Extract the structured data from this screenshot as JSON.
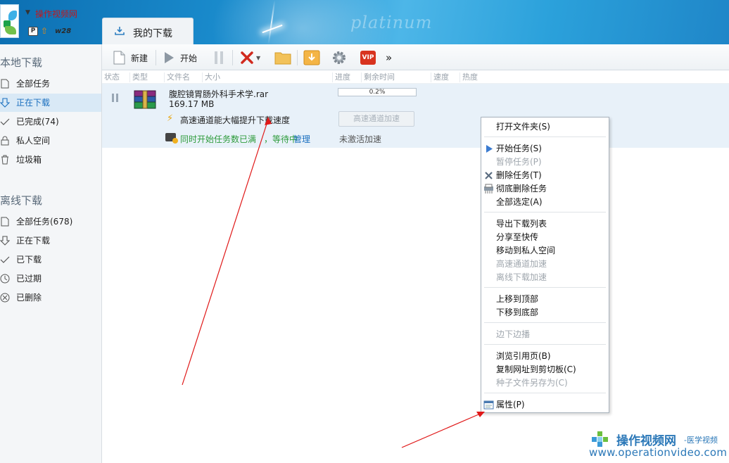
{
  "header": {
    "username": "操作视频网",
    "level": "w28",
    "brand": "platinum",
    "tab_label": "我的下载"
  },
  "sidebar": {
    "local_title": "本地下载",
    "local_items": [
      {
        "label": "全部任务",
        "icon": "document-icon"
      },
      {
        "label": "正在下载",
        "icon": "download-arrow-icon",
        "active": true
      },
      {
        "label": "已完成(74)",
        "icon": "check-icon"
      },
      {
        "label": "私人空间",
        "icon": "lock-icon"
      },
      {
        "label": "垃圾箱",
        "icon": "trash-icon"
      }
    ],
    "offline_title": "离线下载",
    "offline_items": [
      {
        "label": "全部任务(678)",
        "icon": "document-icon"
      },
      {
        "label": "正在下载",
        "icon": "download-arrow-icon"
      },
      {
        "label": "已下载",
        "icon": "check-icon"
      },
      {
        "label": "已过期",
        "icon": "clock-icon"
      },
      {
        "label": "已删除",
        "icon": "circle-x-icon"
      }
    ]
  },
  "toolbar": {
    "new_label": "新建",
    "start_label": "开始",
    "vip_label": "VIP",
    "more_label": "»"
  },
  "columns": [
    "状态",
    "类型",
    "文件名",
    "大小",
    "进度",
    "剩余时间",
    "速度",
    "热度"
  ],
  "task": {
    "name": "腹腔镜胃肠外科手术学.rar",
    "size": "169.17 MB",
    "progress_text": "0.2%",
    "progress": 0.002,
    "boost_msg": "高速通道能大幅提升下载速度",
    "boost_button": "高速通道加速",
    "warn_msg": "同时开始任务数已满",
    "warn_wait": "，等待中",
    "warn_manage": "管理",
    "not_activated": "未激活加速"
  },
  "context_menu": {
    "items": [
      {
        "label": "打开文件夹(S)",
        "enabled": true
      },
      {
        "label": "开始任务(S)",
        "enabled": true,
        "icon": "play-icon"
      },
      {
        "label": "暂停任务(P)",
        "enabled": false
      },
      {
        "label": "删除任务(T)",
        "enabled": true,
        "icon": "delete-x-icon"
      },
      {
        "label": "彻底删除任务",
        "enabled": true,
        "icon": "shredder-icon"
      },
      {
        "label": "全部选定(A)",
        "enabled": true
      },
      {
        "label": "导出下载列表",
        "enabled": true
      },
      {
        "label": "分享至快传",
        "enabled": true
      },
      {
        "label": "移动到私人空间",
        "enabled": true
      },
      {
        "label": "高速通道加速",
        "enabled": false
      },
      {
        "label": "离线下载加速",
        "enabled": false
      },
      {
        "label": "上移到顶部",
        "enabled": true
      },
      {
        "label": "下移到底部",
        "enabled": true
      },
      {
        "label": "边下边播",
        "enabled": false
      },
      {
        "label": "浏览引用页(B)",
        "enabled": true
      },
      {
        "label": "复制网址到剪切板(C)",
        "enabled": true
      },
      {
        "label": "种子文件另存为(C)",
        "enabled": false
      },
      {
        "label": "属性(P)",
        "enabled": true,
        "icon": "properties-icon"
      }
    ]
  },
  "watermark": {
    "cn": "操作视频网",
    "sub": "-医学视频",
    "url": "www.operationvideo.com"
  },
  "colors": {
    "accent": "#1a6fbf",
    "header_blue": "#1c8fd0",
    "selected_row": "#e8f1f9",
    "green_text": "#2d9b3b",
    "arrow_red": "#e01818"
  }
}
